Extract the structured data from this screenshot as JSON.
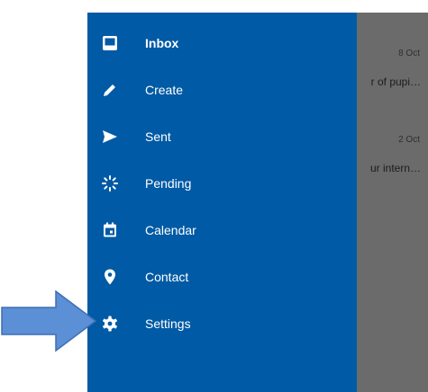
{
  "drawer": {
    "items": [
      {
        "label": "Inbox",
        "icon": "inbox-icon",
        "active": true
      },
      {
        "label": "Create",
        "icon": "pencil-icon"
      },
      {
        "label": "Sent",
        "icon": "send-icon"
      },
      {
        "label": "Pending",
        "icon": "loading-icon"
      },
      {
        "label": "Calendar",
        "icon": "calendar-icon"
      },
      {
        "label": "Contact",
        "icon": "location-pin-icon"
      },
      {
        "label": "Settings",
        "icon": "gear-icon"
      }
    ],
    "background_color": "#005aa5"
  },
  "messages": [
    {
      "date": "8 Oct",
      "snippet": "r of pupi…"
    },
    {
      "date": "2 Oct",
      "snippet": "ur intern…"
    }
  ],
  "annotation": {
    "arrow_color": "#5b8fd6",
    "points_to": "gear-icon"
  }
}
